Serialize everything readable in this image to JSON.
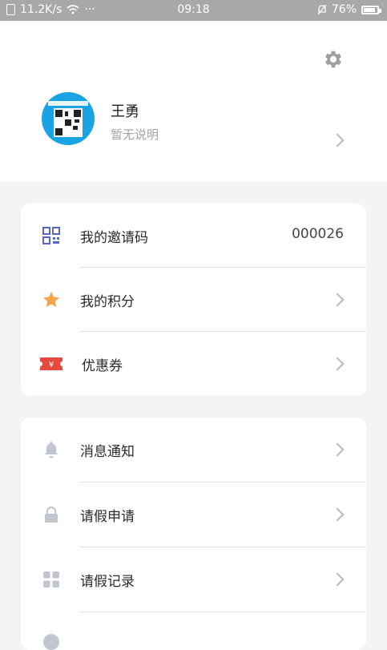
{
  "status_bar": {
    "speed": "11.2K/s",
    "dots": "···",
    "time": "09:18",
    "battery": "76%",
    "battery_level": 0.76
  },
  "profile": {
    "name": "王勇",
    "description": "暂无说明"
  },
  "card1": [
    {
      "label": "我的邀请码",
      "value": "000026",
      "icon": "qr-code-icon"
    },
    {
      "label": "我的积分",
      "icon": "star-icon"
    },
    {
      "label": "优惠券",
      "icon": "coupon-icon"
    }
  ],
  "card2": [
    {
      "label": "消息通知",
      "icon": "bell-icon"
    },
    {
      "label": "请假申请",
      "icon": "lock-icon"
    },
    {
      "label": "请假记录",
      "icon": "grid-icon"
    }
  ],
  "colors": {
    "accent_icon": "#5865c4",
    "star": "#f2a54b",
    "coupon": "#e64a3d",
    "gray_icon": "#c2c6d0",
    "status_bar": "#a8a8a8"
  }
}
